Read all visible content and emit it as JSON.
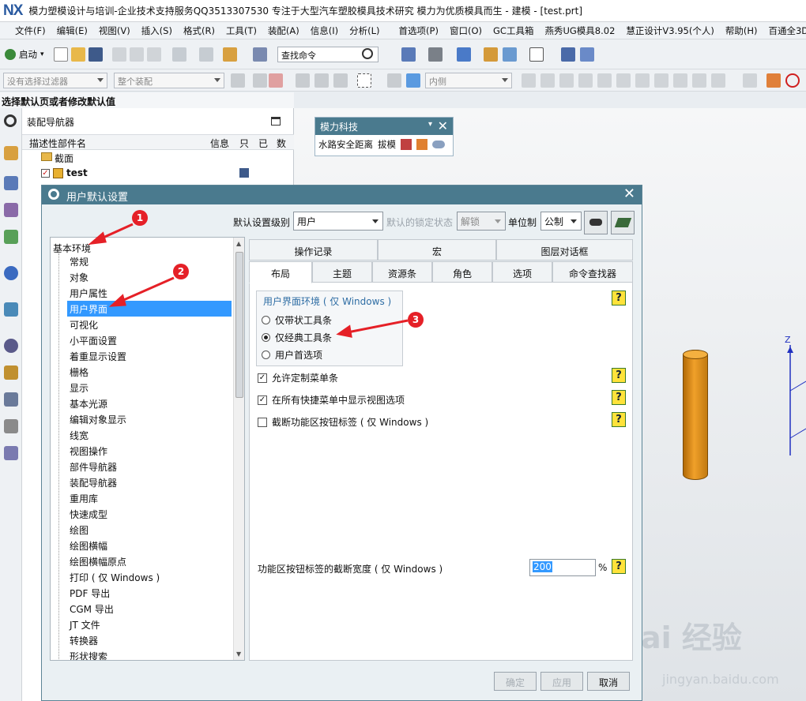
{
  "window": {
    "logo": "NX",
    "title": "模力塑模设计与培训-企业技术支持服务QQ3513307530  专注于大型汽车塑胶模具技术研究  模力为优质模具而生 - 建模 - [test.prt]"
  },
  "menubar": {
    "items": [
      "文件(F)",
      "编辑(E)",
      "视图(V)",
      "插入(S)",
      "格式(R)",
      "工具(T)",
      "装配(A)",
      "信息(I)",
      "分析(L)",
      "首选项(P)",
      "窗口(O)",
      "GC工具箱",
      "燕秀UG模具8.02",
      "慧正设计V3.95(个人)",
      "帮助(H)",
      "百通全3D设计(D)"
    ]
  },
  "toolbar": {
    "start_label": "启动",
    "command_search_placeholder": "查找命令"
  },
  "selection_bar": {
    "filter_placeholder": "没有选择过滤器",
    "scope_placeholder": "整个装配",
    "side_placeholder": "内侧"
  },
  "status": {
    "prompt": "选择默认页或者修改默认值"
  },
  "navigator": {
    "title": "装配导航器",
    "columns": [
      "描述性部件名",
      "信息",
      "只",
      "已",
      "数"
    ],
    "rows": [
      {
        "name": "截面"
      },
      {
        "name": "test"
      }
    ]
  },
  "float_toolbar": {
    "title": "模力科技",
    "items": [
      "水路安全距离",
      "拔模"
    ]
  },
  "dialog": {
    "title": "用户默认设置",
    "level_label": "默认设置级别",
    "level_value": "用户",
    "lock_label": "默认的锁定状态",
    "lock_value": "解锁",
    "unit_label": "单位制",
    "unit_value": "公制",
    "tree_root": "基本环境",
    "tree_items": [
      "常规",
      "对象",
      "用户属性",
      "用户界面",
      "可视化",
      "小平面设置",
      "着重显示设置",
      "栅格",
      "显示",
      "基本光源",
      "编辑对象显示",
      "线宽",
      "视图操作",
      "部件导航器",
      "装配导航器",
      "重用库",
      "快速成型",
      "绘图",
      "绘图横幅",
      "绘图横幅原点",
      "打印 ( 仅 Windows )",
      "PDF 导出",
      "CGM 导出",
      "JT 文件",
      "转换器",
      "形状搜索"
    ],
    "selected_tree_item": "用户界面",
    "tabs_row1": [
      "操作记录",
      "宏",
      "图层对话框"
    ],
    "tabs_row2": [
      "布局",
      "主题",
      "资源条",
      "角色",
      "选项",
      "命令查找器"
    ],
    "active_tab": "布局",
    "group_title": "用户界面环境 ( 仅 Windows )",
    "radio_options": [
      "仅带状工具条",
      "仅经典工具条",
      "用户首选项"
    ],
    "selected_radio": "仅经典工具条",
    "checkbox_1": "允许定制菜单条",
    "checkbox_2": "在所有快捷菜单中显示视图选项",
    "checkbox_3": "截断功能区按钮标签 ( 仅 Windows )",
    "width_label": "功能区按钮标签的截断宽度 ( 仅 Windows )",
    "width_value": "200",
    "width_unit": "%",
    "buttons": {
      "ok": "确定",
      "apply": "应用",
      "cancel": "取消"
    }
  },
  "annotations": [
    "1",
    "2",
    "3"
  ],
  "axis_label": "Z",
  "watermark": {
    "brand": "Bai 经验",
    "url": "jingyan.baidu.com"
  }
}
